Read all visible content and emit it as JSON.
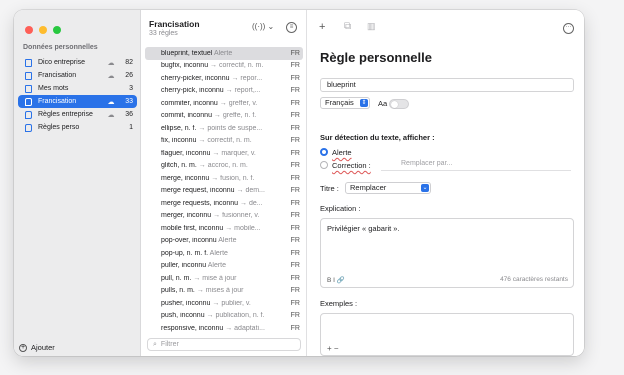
{
  "sidebar": {
    "heading": "Données personnelles",
    "items": [
      {
        "label": "Dico entreprise",
        "cloud": "☁",
        "count": "82",
        "selected": false,
        "kind": "doc"
      },
      {
        "label": "Francisation",
        "cloud": "☁",
        "count": "26",
        "selected": false,
        "kind": "doc"
      },
      {
        "label": "Mes mots",
        "cloud": "",
        "count": "3",
        "selected": false,
        "kind": "doc"
      },
      {
        "label": "Francisation",
        "cloud": "☁",
        "count": "33",
        "selected": true,
        "kind": "bubble"
      },
      {
        "label": "Règles entreprise",
        "cloud": "☁",
        "count": "36",
        "selected": false,
        "kind": "bubble"
      },
      {
        "label": "Règles perso",
        "cloud": "",
        "count": "1",
        "selected": false,
        "kind": "bubble"
      }
    ],
    "add_label": "Ajouter"
  },
  "list": {
    "title": "Francisation",
    "subtitle": "33 règles",
    "filter_placeholder": "Filtrer",
    "rows": [
      {
        "text": "blueprint, textuel",
        "hint": "Alerte",
        "lang": "FR",
        "selected": true
      },
      {
        "text": "bugfix, inconnu",
        "hint": "→ correctif, n. m.",
        "lang": "FR"
      },
      {
        "text": "cherry-picker, inconnu",
        "hint": "→ repor...",
        "lang": "FR"
      },
      {
        "text": "cherry-pick, inconnu",
        "hint": "→ report,...",
        "lang": "FR"
      },
      {
        "text": "commiter, inconnu",
        "hint": "→ greffer, v.",
        "lang": "FR"
      },
      {
        "text": "commit, inconnu",
        "hint": "→ greffe, n. f.",
        "lang": "FR"
      },
      {
        "text": "ellipse, n. f.",
        "hint": "→ points de suspe...",
        "lang": "FR"
      },
      {
        "text": "fix, inconnu",
        "hint": "→ correctif, n. m.",
        "lang": "FR"
      },
      {
        "text": "flaguer, inconnu",
        "hint": "→ marquer, v.",
        "lang": "FR"
      },
      {
        "text": "glitch, n. m.",
        "hint": "→ accroc, n. m.",
        "lang": "FR"
      },
      {
        "text": "merge, inconnu",
        "hint": "→ fusion, n. f.",
        "lang": "FR"
      },
      {
        "text": "merge request, inconnu",
        "hint": "→ dem...",
        "lang": "FR"
      },
      {
        "text": "merge requests, inconnu",
        "hint": "→ de...",
        "lang": "FR"
      },
      {
        "text": "merger, inconnu",
        "hint": "→ fusionner, v.",
        "lang": "FR"
      },
      {
        "text": "mobile first, inconnu",
        "hint": "→ mobile...",
        "lang": "FR"
      },
      {
        "text": "pop-over, inconnu",
        "hint": "Alerte",
        "lang": "FR"
      },
      {
        "text": "pop-up, n. m. f.",
        "hint": "Alerte",
        "lang": "FR"
      },
      {
        "text": "puller, inconnu",
        "hint": "Alerte",
        "lang": "FR"
      },
      {
        "text": "pull, n. m.",
        "hint": "→ mise à jour",
        "lang": "FR"
      },
      {
        "text": "pulls, n. m.",
        "hint": "→ mises à jour",
        "lang": "FR"
      },
      {
        "text": "pusher, inconnu",
        "hint": "→ publier, v.",
        "lang": "FR"
      },
      {
        "text": "push, inconnu",
        "hint": "→ publication, n. f.",
        "lang": "FR"
      },
      {
        "text": "responsive, inconnu",
        "hint": "→ adaptati...",
        "lang": "FR"
      }
    ]
  },
  "editor": {
    "toolbar": {
      "add": "+",
      "duplicate": "⧉",
      "delete": "🗑",
      "more": "···"
    },
    "title": "Règle personnelle",
    "term": "blueprint",
    "language": "Français",
    "case_label": "Aa :",
    "detect_label": "Sur détection du texte, afficher :",
    "opt_alert": "Alerte",
    "opt_correction": "Correction :",
    "correction_placeholder": "Remplacer par...",
    "title_label": "Titre :",
    "title_value": "Remplacer",
    "explanation_label": "Explication :",
    "explanation_text": "Privilégier « gabarit ».",
    "format_btns": "B  I  🔗",
    "char_count": "476 caractères restants",
    "examples_label": "Exemples :",
    "examples_btns": "+   −"
  },
  "colors": {
    "accent": "#2a72e8",
    "traffic": [
      "#fe5f57",
      "#febc2e",
      "#28c840"
    ]
  }
}
